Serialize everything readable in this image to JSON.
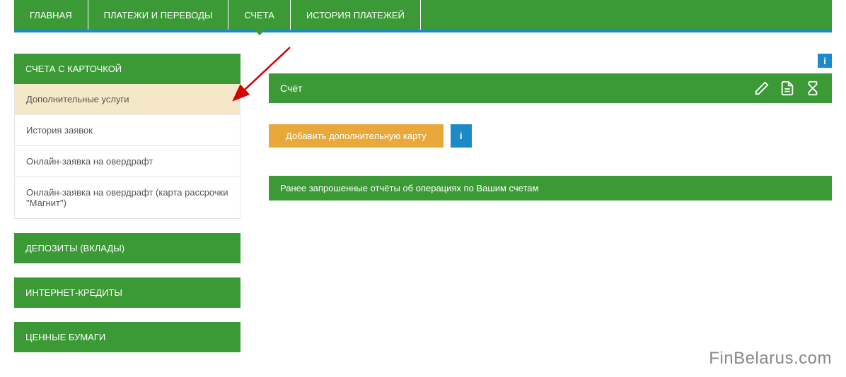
{
  "nav": {
    "tabs": [
      {
        "label": "ГЛАВНАЯ",
        "active": false
      },
      {
        "label": "ПЛАТЕЖИ И ПЕРЕВОДЫ",
        "active": false
      },
      {
        "label": "СЧЕТА",
        "active": true
      },
      {
        "label": "ИСТОРИЯ ПЛАТЕЖЕЙ",
        "active": false
      }
    ]
  },
  "sidebar": {
    "sections": [
      {
        "header": "СЧЕТА С КАРТОЧКОЙ",
        "items": [
          {
            "label": "Дополнительные услуги",
            "selected": true
          },
          {
            "label": "История заявок",
            "selected": false
          },
          {
            "label": "Онлайн-заявка на овердрафт",
            "selected": false
          },
          {
            "label": "Онлайн-заявка на овердрафт (карта рассрочки \"Магнит\")",
            "selected": false
          }
        ]
      },
      {
        "header": "ДЕПОЗИТЫ (ВКЛАДЫ)",
        "items": []
      },
      {
        "header": "ИНТЕРНЕТ-КРЕДИТЫ",
        "items": []
      },
      {
        "header": "ЦЕННЫЕ БУМАГИ",
        "items": []
      }
    ]
  },
  "main": {
    "info_label": "i",
    "account_label": "Счёт",
    "add_card_label": "Добавить дополнительную карту",
    "info_btn_label": "i",
    "reports_label": "Ранее запрошенные отчёты об операциях по Вашим счетам"
  },
  "watermark": "FinBelarus.com"
}
